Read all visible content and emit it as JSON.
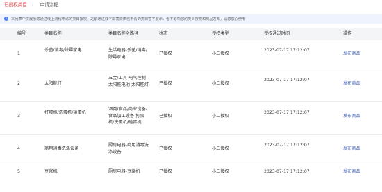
{
  "tabs": [
    {
      "label": "已授权类目"
    },
    {
      "label": "申请流程"
    }
  ],
  "tab_separator": "›",
  "notice": {
    "icon": "info-icon",
    "text": "本列表中仅展示您通过线上流程申请的类目授权，之前通过线下邮寄资质已申请的类目暂不展示，但不影响您的类目授权和商品发布，请您放心使用"
  },
  "table": {
    "headers": {
      "no": "编号",
      "name": "类目名称",
      "path": "类目名称全路径",
      "status": "状态",
      "type": "授权类型",
      "time": "授权通过时间",
      "op": "操作"
    },
    "rows": [
      {
        "no": "1",
        "name": "杀菌/消毒/除霉家电",
        "path": "生活电器-杀菌/消毒/除霉家电",
        "status": "已授权",
        "type": "小二授权",
        "time": "2023-07-17 17:12:07",
        "op": "发布商品"
      },
      {
        "no": "2",
        "name": "太阳能灯",
        "path": "五金/工具-电气控制-太阳能电池-太阳能灯",
        "status": "已授权",
        "type": "小二授权",
        "time": "2023-07-17 17:12:07",
        "op": "发布商品"
      },
      {
        "no": "3",
        "name": "打蛋机/洗蛋机/磕蛋机",
        "path": "酒类/食品/商业设备-食品加工设备-打蛋机/洗蛋机/磕蛋机",
        "status": "已授权",
        "type": "小二授权",
        "time": "2023-07-17 17:12:07",
        "op": "发布商品"
      },
      {
        "no": "4",
        "name": "商用消毒洗涤设备",
        "path": "厨房电器-商用消毒洗涤设备",
        "status": "已授权",
        "type": "小二授权",
        "time": "2023-07-17 17:12:07",
        "op": "发布商品"
      },
      {
        "no": "5",
        "name": "豆浆机",
        "path": "厨房电器-豆浆机",
        "status": "已授权",
        "type": "小二授权",
        "time": "2023-07-17 17:12:07",
        "op": "发布商品"
      }
    ]
  }
}
